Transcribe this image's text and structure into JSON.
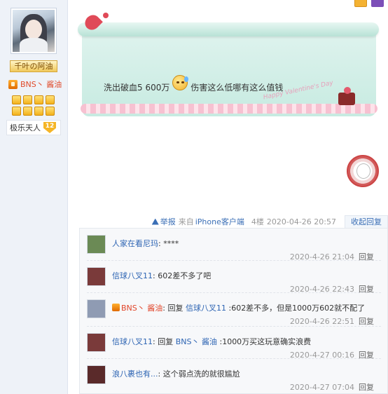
{
  "sidebar": {
    "rank": "千叶の阿油",
    "medal_name": "BNS丶  酱油",
    "level_name": "极乐天人",
    "level_number": "12"
  },
  "post": {
    "text_before": "洗出破血5 600万",
    "text_after": "伤害这么低哪有这么值钱",
    "stamp": "Happy Valentine's Day"
  },
  "meta": {
    "report": "举报",
    "from_prefix": "来自",
    "client": "iPhone客户端",
    "floor": "4楼",
    "date": "2020-04-26 20:57",
    "collapse_reply": "收起回复"
  },
  "replies": [
    {
      "name": "人家在看尼玛",
      "colon": ":",
      "content": "****",
      "time": "2020-4-26 21:04",
      "reply_label": "回复",
      "avatar_color": "#6b8a55"
    },
    {
      "name": "信球八叉11",
      "colon": ":",
      "content": "602差不多了吧",
      "time": "2020-4-26 22:43",
      "reply_label": "回复",
      "avatar_color": "#7a3a3a"
    },
    {
      "name": "BNS丶  酱油",
      "colon": ":",
      "reply_word": "回复",
      "target": "信球八叉11",
      "content": ":602差不多，但是1000万602就不配了",
      "time": "2020-4-26 22:51",
      "reply_label": "回复",
      "avatar_color": "#8f9bb3"
    },
    {
      "name": "信球八叉11",
      "colon": ":",
      "reply_word": "回复",
      "target": "BNS丶  酱油",
      "content": ":1000万买这玩意确实浪费",
      "time": "2020-4-27 00:16",
      "reply_label": "回复",
      "avatar_color": "#7a3a3a"
    },
    {
      "name": "浪八裹也有...",
      "colon": ":",
      "content": "这个弱点洗的就很尴尬",
      "time": "2020-4-27 07:04",
      "reply_label": "回复",
      "avatar_color": "#5a2a2a"
    }
  ]
}
